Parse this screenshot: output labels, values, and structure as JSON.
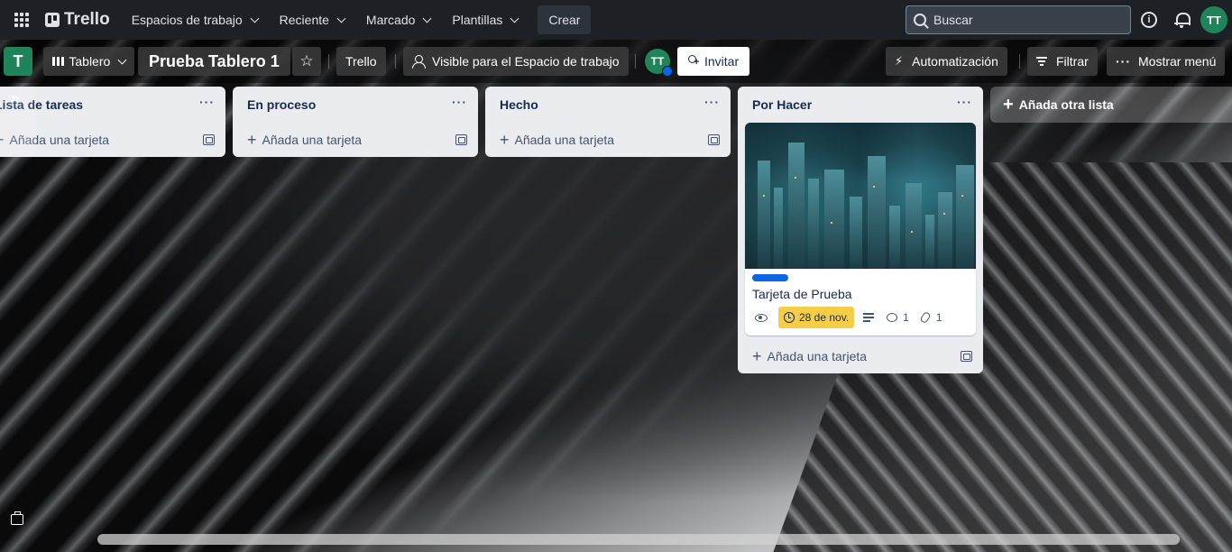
{
  "topbar": {
    "app_name": "Trello",
    "nav": [
      {
        "label": "Espacios de trabajo",
        "dropdown": true
      },
      {
        "label": "Reciente",
        "dropdown": true
      },
      {
        "label": "Marcado",
        "dropdown": true
      },
      {
        "label": "Plantillas",
        "dropdown": true
      }
    ],
    "create_label": "Crear",
    "search_placeholder": "Buscar",
    "info_glyph": "i",
    "user_initials": "TT"
  },
  "board": {
    "workspace_initial": "T",
    "view_label": "Tablero",
    "title": "Prueba Tablero 1",
    "workspace_label": "Trello",
    "visibility_label": "Visible para el Espacio de trabajo",
    "member_initials": "TT",
    "invite_label": "Invitar",
    "automation_label": "Automatización",
    "filter_label": "Filtrar",
    "menu_label": "Mostrar menú"
  },
  "lists": [
    {
      "title": "Lista de tareas",
      "add_card_label": "Añada una tarjeta"
    },
    {
      "title": "En proceso",
      "add_card_label": "Añada una tarjeta"
    },
    {
      "title": "Hecho",
      "add_card_label": "Añada una tarjeta"
    },
    {
      "title": "Por Hacer",
      "add_card_label": "Añada una tarjeta"
    }
  ],
  "card": {
    "title": "Tarjeta de Prueba",
    "label_color": "#0c66e4",
    "due_label": "28 de nov.",
    "due_color": "#f5cd47",
    "comments": "1",
    "attachments": "1"
  },
  "add_list_label": "Añada otra lista",
  "colors": {
    "topbar": "#1d2125",
    "accent_green": "#1f845a",
    "list_bg": "#ebecf0"
  }
}
